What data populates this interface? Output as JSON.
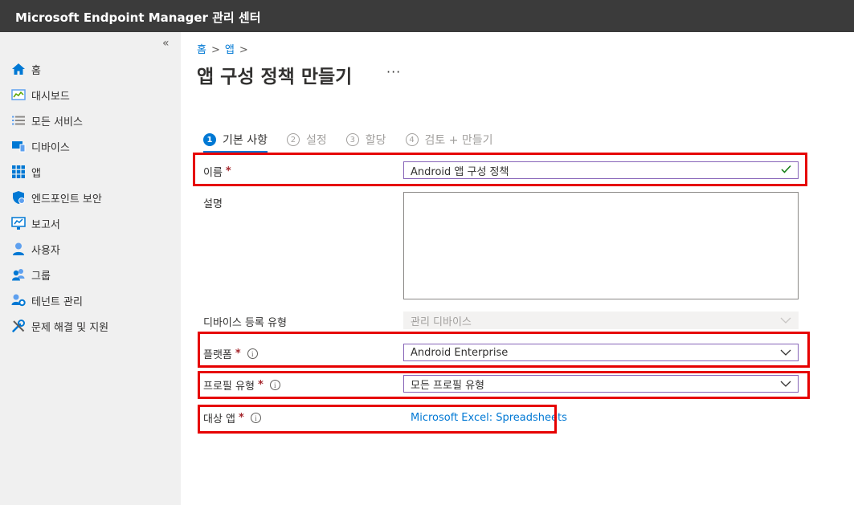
{
  "app": {
    "title": "Microsoft Endpoint Manager 관리 센터"
  },
  "sidebar": {
    "collapse_glyph": "«",
    "items": [
      {
        "label": "홈",
        "icon": "home-icon"
      },
      {
        "label": "대시보드",
        "icon": "dashboard-icon"
      },
      {
        "label": "모든 서비스",
        "icon": "list-icon"
      },
      {
        "label": "디바이스",
        "icon": "devices-icon"
      },
      {
        "label": "앱",
        "icon": "apps-grid-icon"
      },
      {
        "label": "엔드포인트 보안",
        "icon": "shield-icon"
      },
      {
        "label": "보고서",
        "icon": "reports-icon"
      },
      {
        "label": "사용자",
        "icon": "user-icon"
      },
      {
        "label": "그룹",
        "icon": "group-icon"
      },
      {
        "label": "테넌트 관리",
        "icon": "tenant-icon"
      },
      {
        "label": "문제 해결 및 지원",
        "icon": "wrench-icon"
      }
    ]
  },
  "breadcrumb": [
    "홈",
    "앱"
  ],
  "page": {
    "title": "앱 구성 정책 만들기",
    "more": "···"
  },
  "steps": [
    {
      "num": "1",
      "label": "기본 사항",
      "active": true
    },
    {
      "num": "2",
      "label": "설정",
      "active": false
    },
    {
      "num": "3",
      "label": "할당",
      "active": false
    },
    {
      "num": "4",
      "label": "검토 + 만들기",
      "active": false
    }
  ],
  "form": {
    "name": {
      "label": "이름",
      "required": "*",
      "value": "Android 앱 구성 정책"
    },
    "description": {
      "label": "설명",
      "value": ""
    },
    "enrollment": {
      "label": "디바이스 등록 유형",
      "value": "관리 디바이스"
    },
    "platform": {
      "label": "플랫폼",
      "required": "*",
      "info": "i",
      "value": "Android Enterprise"
    },
    "profile_type": {
      "label": "프로필 유형",
      "required": "*",
      "info": "i",
      "value": "모든 프로필 유형"
    },
    "target_app": {
      "label": "대상 앱",
      "required": "*",
      "info": "i",
      "value": "Microsoft Excel: Spreadsheets"
    }
  },
  "colors": {
    "accent": "#0078d4",
    "highlight": "#e60000",
    "topbar": "#3b3b3b",
    "check": "#107c10"
  }
}
